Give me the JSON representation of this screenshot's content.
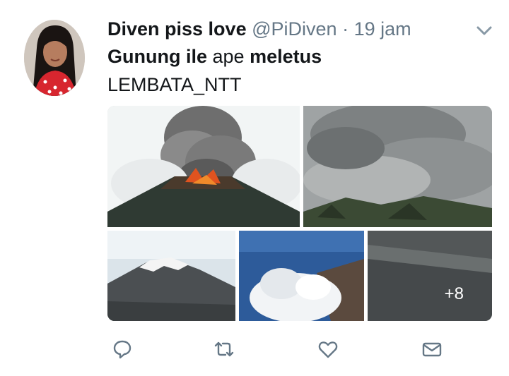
{
  "tweet": {
    "display_name": "Diven piss love",
    "handle": "@PiDiven",
    "separator": "·",
    "time": "19 jam",
    "text_line1_part1": "Gunung ile",
    "text_line1_part2": " ape ",
    "text_line1_part3": "meletus",
    "text_line2": "LEMBATA_NTT"
  },
  "media": {
    "more_count": "+8",
    "items": [
      {
        "name": "eruption-photo"
      },
      {
        "name": "ash-cloud-photo"
      },
      {
        "name": "snowy-peak-photo"
      },
      {
        "name": "aerial-cloud-photo"
      },
      {
        "name": "ash-slope-photo"
      }
    ]
  },
  "actions": [
    {
      "name": "reply-icon"
    },
    {
      "name": "retweet-icon"
    },
    {
      "name": "like-icon"
    },
    {
      "name": "message-icon"
    }
  ],
  "colors": {
    "text": "#14171a",
    "secondary": "#657786",
    "icon": "#657786",
    "background": "#ffffff"
  }
}
